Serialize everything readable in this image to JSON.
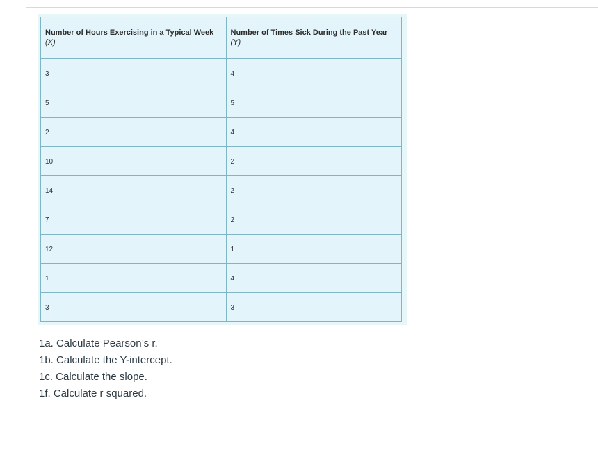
{
  "table": {
    "headers": [
      {
        "label": "Number of Hours Exercising in a Typical Week",
        "sub": "(X)"
      },
      {
        "label": "Number of Times Sick During the Past Year",
        "sub": "(Y)"
      }
    ],
    "rows": [
      [
        "3",
        "4"
      ],
      [
        "5",
        "5"
      ],
      [
        "2",
        "4"
      ],
      [
        "10",
        "2"
      ],
      [
        "14",
        "2"
      ],
      [
        "7",
        "2"
      ],
      [
        "12",
        "1"
      ],
      [
        "1",
        "4"
      ],
      [
        "3",
        "3"
      ]
    ]
  },
  "questions": [
    "1a. Calculate Pearson’s r.",
    "1b. Calculate the Y-intercept.",
    "1c. Calculate the slope.",
    "1f. Calculate r squared."
  ]
}
